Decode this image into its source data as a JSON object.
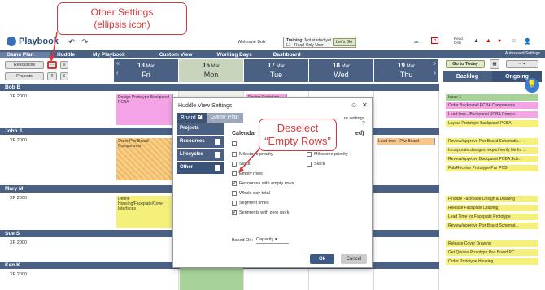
{
  "app": {
    "name": "Playbook"
  },
  "topbar": {
    "welcome": "Welcome Bob",
    "training_label": "Training:",
    "training_status": "Not started yet",
    "training_detail": "L1 - Read-Only User",
    "lets_go": "Let's Go",
    "read_only": "Read Only",
    "badge": "5"
  },
  "menu": {
    "items": [
      "Game Plan",
      "Huddle",
      "My Playbook",
      "Custom View",
      "Working Days",
      "Dashboard"
    ],
    "active": "Game Plan",
    "autosaved": "Autosaved Settings"
  },
  "subbar": {
    "resources": "Resources",
    "projects": "Projects",
    "goto_today": "Go to Today"
  },
  "days": [
    {
      "date": "13",
      "month": "Mar",
      "dow": "Fri"
    },
    {
      "date": "16",
      "month": "Mar",
      "dow": "Mon"
    },
    {
      "date": "17",
      "month": "Mar",
      "dow": "Tue"
    },
    {
      "date": "18",
      "month": "Mar",
      "dow": "Wed"
    },
    {
      "date": "19",
      "month": "Mar",
      "dow": "Thu"
    }
  ],
  "right_tabs": {
    "backlog": "Backlog",
    "ongoing": "Ongoing"
  },
  "resources": [
    {
      "name": "Bob B",
      "sub": "XP 2000"
    },
    {
      "name": "John J",
      "sub": "XP 2000"
    },
    {
      "name": "Mary M",
      "sub": "XP 2000"
    },
    {
      "name": "Sue S",
      "sub": "XP 2000"
    },
    {
      "name": "Ken K",
      "sub": "XP 2000"
    }
  ],
  "tasks": {
    "bob_fri": "Design Prototype Backpanel PCBA",
    "bob_mon": "Design Prototype",
    "bob_tue": "Design Prototype",
    "john_fri": "Order Pwr Board Components",
    "john_thu": "Lead time - Pwr Board",
    "mary_fri": "Define Housing/Faceplate/Cover Interfaces"
  },
  "right_items": {
    "bob": [
      "Issue 1",
      "Order Backpanel PCBA Components",
      "Lead time - Backpanel PCBA Compo...",
      "Layout Prototype Backpanel PCBA"
    ],
    "john": [
      "Review/Approve Pwr Board Schematic...",
      "Incorporate changes, export/verify file for ...",
      "Review/Approve Backpanel PCBA Sch...",
      "Fab/Receive Prototype Pwr PCB"
    ],
    "mary": [
      "Finalize Faceplate Design & Drawing",
      "Release Faceplate Drawing",
      "Lead Time for Faceplate Prototype",
      "Review/Approve Pwr Board Schemat..."
    ],
    "sue": [
      "Release Cover Drawing",
      "Get Quotes Prototype Pwr Board PC...",
      "Order Prototype Housing"
    ]
  },
  "dialog": {
    "title": "Huddle View Settings",
    "tabs": [
      "Board",
      "Game Plan"
    ],
    "side": [
      "Projects",
      "Resources",
      "Lifecycles",
      "Other"
    ],
    "section_title": "Calendar",
    "section_suffix": "ed)",
    "more_settings": "re settings",
    "options_left": [
      "Milestone priority",
      "Slack",
      "Empty rows",
      "Resources with empty rows",
      "Whole day total",
      "Segment times",
      "Segments with zero work"
    ],
    "options_right": [
      "Milestone priority",
      "Slack"
    ],
    "based_on_label": "Based On:",
    "based_on_value": "Capacity",
    "ok": "Ok",
    "cancel": "Cancel"
  },
  "callouts": {
    "other_settings": "Other Settings\n(ellipsis icon)",
    "deselect": "Deselect\n“Empty Rows”"
  },
  "colors": {
    "nav": "#4a6184",
    "accent": "#d9383a",
    "today": "#c8d4bc"
  }
}
